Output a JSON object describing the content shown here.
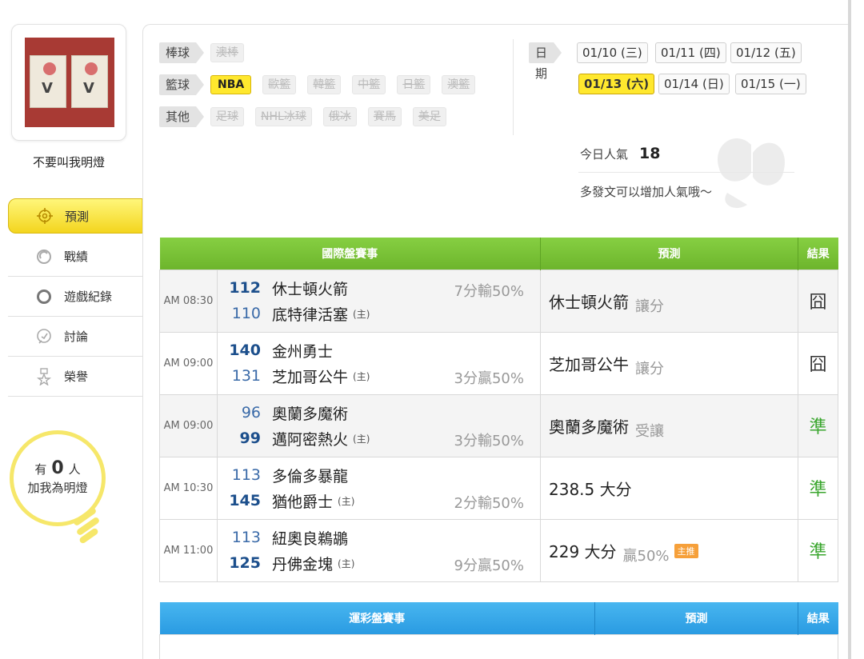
{
  "user": {
    "name": "不要叫我明燈"
  },
  "nav": [
    {
      "label": "預測",
      "icon": "target-icon",
      "active": true
    },
    {
      "label": "戰績",
      "icon": "record-icon",
      "active": false
    },
    {
      "label": "遊戲紀錄",
      "icon": "circle-icon",
      "active": false
    },
    {
      "label": "討論",
      "icon": "discuss-icon",
      "active": false
    },
    {
      "label": "榮譽",
      "icon": "medal-icon",
      "active": false
    }
  ],
  "followers": {
    "prefix": "有",
    "count": "0",
    "suffix": "人",
    "line2": "加我為明燈"
  },
  "categories": {
    "baseball": {
      "label": "棒球",
      "options": [
        "澳棒"
      ]
    },
    "basketball": {
      "label": "籃球",
      "options": [
        "NBA",
        "歐籃",
        "韓籃",
        "中籃",
        "日籃",
        "澳籃"
      ],
      "selected": "NBA"
    },
    "other": {
      "label": "其他",
      "options": [
        "足球",
        "NHL冰球",
        "俄冰",
        "賽馬",
        "美足"
      ]
    }
  },
  "dates": {
    "label": "日期",
    "items": [
      "01/10 (三)",
      "01/11 (四)",
      "01/12 (五)",
      "01/13 (六)",
      "01/14 (日)",
      "01/15 (一)"
    ],
    "selected": "01/13 (六)"
  },
  "popularity": {
    "label": "今日人氣",
    "value": "18",
    "tip": "多發文可以增加人氣哦～"
  },
  "intl_table": {
    "headers": [
      "國際盤賽事",
      "預測",
      "結果"
    ],
    "rows": [
      {
        "time": "AM 08:30",
        "away_score": "112",
        "away": "休士頓火箭",
        "home_score": "110",
        "home": "底特律活塞",
        "home_mark": "(主)",
        "spread": "7分輸50%",
        "spread_pos": "top",
        "winner": "away",
        "pick": "休士頓火箭",
        "pick_type": "讓分",
        "badge": "",
        "result": "囧",
        "result_kind": "miss"
      },
      {
        "time": "AM 09:00",
        "away_score": "140",
        "away": "金州勇士",
        "home_score": "131",
        "home": "芝加哥公牛",
        "home_mark": "(主)",
        "spread": "3分贏50%",
        "spread_pos": "bot",
        "winner": "away",
        "pick": "芝加哥公牛",
        "pick_type": "讓分",
        "badge": "",
        "result": "囧",
        "result_kind": "miss"
      },
      {
        "time": "AM 09:00",
        "away_score": "96",
        "away": "奧蘭多魔術",
        "home_score": "99",
        "home": "邁阿密熱火",
        "home_mark": "(主)",
        "spread": "3分輸50%",
        "spread_pos": "bot",
        "winner": "home",
        "pick": "奧蘭多魔術",
        "pick_type": "受讓",
        "badge": "",
        "result": "準",
        "result_kind": "hit"
      },
      {
        "time": "AM 10:30",
        "away_score": "113",
        "away": "多倫多暴龍",
        "home_score": "145",
        "home": "猶他爵士",
        "home_mark": "(主)",
        "spread": "2分輸50%",
        "spread_pos": "bot",
        "winner": "home",
        "pick": "238.5 大分",
        "pick_type": "",
        "badge": "",
        "result": "準",
        "result_kind": "hit"
      },
      {
        "time": "AM 11:00",
        "away_score": "113",
        "away": "紐奧良鵜鶘",
        "home_score": "125",
        "home": "丹佛金塊",
        "home_mark": "(主)",
        "spread": "9分贏50%",
        "spread_pos": "bot",
        "winner": "home",
        "pick": "229 大分",
        "pick_type": "贏50%",
        "badge": "主推",
        "result": "準",
        "result_kind": "hit"
      }
    ]
  },
  "sport_table": {
    "headers": [
      "運彩盤賽事",
      "預測",
      "結果"
    ]
  }
}
